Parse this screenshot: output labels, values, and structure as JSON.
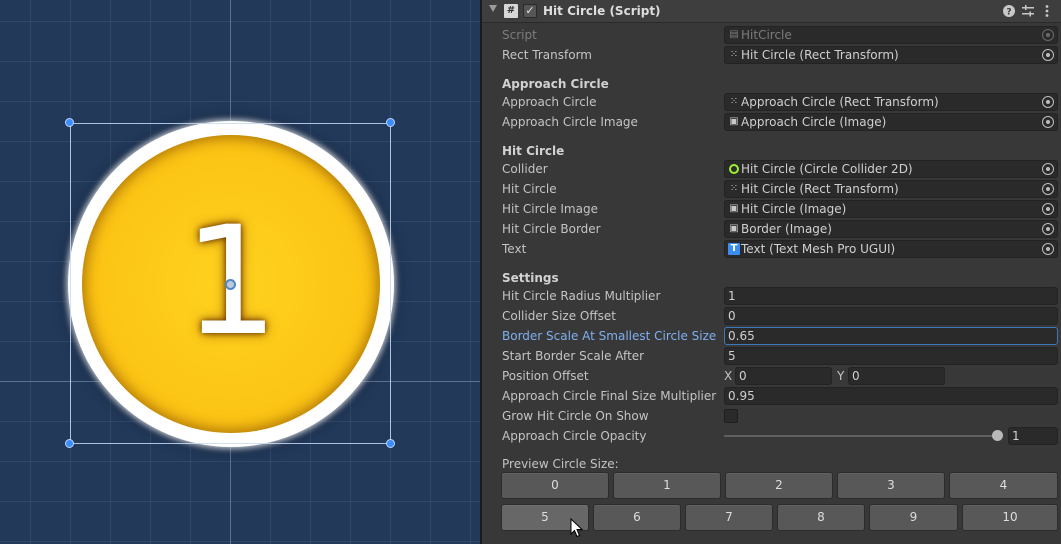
{
  "scene": {
    "circle_number": "1"
  },
  "component": {
    "title": "Hit Circle (Script)",
    "enabled_check": "✓",
    "icons": [
      "script-icon",
      "help-icon",
      "preset-icon",
      "more-icon"
    ]
  },
  "fields": {
    "script": {
      "label": "Script",
      "value": "HitCircle"
    },
    "rect_transform": {
      "label": "Rect Transform",
      "value": "Hit Circle (Rect Transform)"
    }
  },
  "approach_section": {
    "header": "Approach Circle",
    "approach_circle": {
      "label": "Approach Circle",
      "value": "Approach Circle (Rect Transform)"
    },
    "approach_circle_image": {
      "label": "Approach Circle Image",
      "value": "Approach Circle (Image)"
    }
  },
  "hit_section": {
    "header": "Hit Circle",
    "collider": {
      "label": "Collider",
      "value": "Hit Circle (Circle Collider 2D)"
    },
    "hit_circle": {
      "label": "Hit Circle",
      "value": "Hit Circle (Rect Transform)"
    },
    "hit_circle_image": {
      "label": "Hit Circle Image",
      "value": "Hit Circle (Image)"
    },
    "hit_circle_border": {
      "label": "Hit Circle Border",
      "value": "Border (Image)"
    },
    "text": {
      "label": "Text",
      "value": "Text (Text Mesh Pro UGUI)",
      "icon_glyph": "T"
    }
  },
  "settings_section": {
    "header": "Settings",
    "radius_multiplier": {
      "label": "Hit Circle Radius Multiplier",
      "value": "1"
    },
    "collider_offset": {
      "label": "Collider Size Offset",
      "value": "0"
    },
    "border_scale": {
      "label": "Border Scale At Smallest Circle Size",
      "value": "0.65"
    },
    "start_border_scale": {
      "label": "Start Border Scale After",
      "value": "5"
    },
    "position_offset": {
      "label": "Position Offset",
      "x_label": "X",
      "x_value": "0",
      "y_label": "Y",
      "y_value": "0"
    },
    "approach_final_size": {
      "label": "Approach Circle Final Size Multiplier",
      "value": "0.95"
    },
    "grow_on_show": {
      "label": "Grow Hit Circle On Show",
      "checked": false
    },
    "approach_opacity": {
      "label": "Approach Circle Opacity",
      "value": "1",
      "fraction": 1.0
    }
  },
  "preview": {
    "label": "Preview Circle Size:",
    "row1": [
      "0",
      "1",
      "2",
      "3",
      "4"
    ],
    "row2": [
      "5",
      "6",
      "7",
      "8",
      "9",
      "10"
    ]
  },
  "colors": {
    "accent_focus": "#3a79bb",
    "active_label": "#7fb0f0",
    "circle_fill": "#fcc515",
    "handle": "#3a8dfa"
  }
}
